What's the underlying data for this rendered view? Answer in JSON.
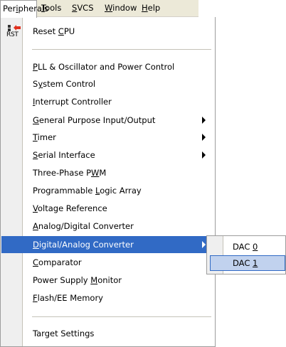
{
  "menubar": {
    "items": [
      {
        "pre": "Per",
        "key": "i",
        "post": "pherals"
      },
      {
        "pre": "",
        "key": "T",
        "post": "ools"
      },
      {
        "pre": "",
        "key": "S",
        "post": "VCS"
      },
      {
        "pre": "",
        "key": "W",
        "post": "indow"
      },
      {
        "pre": "",
        "key": "H",
        "post": "elp"
      }
    ]
  },
  "menu": {
    "reset": {
      "icon_text": "RST",
      "icon": "reset-cpu-icon",
      "pre": "Reset ",
      "key": "C",
      "post": "PU"
    },
    "items": [
      {
        "pre": "",
        "key": "P",
        "post": "LL & Oscillator and Power Control"
      },
      {
        "pre": "S",
        "key": "y",
        "post": "stem Control"
      },
      {
        "pre": "",
        "key": "I",
        "post": "nterrupt Controller"
      },
      {
        "pre": "",
        "key": "G",
        "post": "eneral Purpose Input/Output",
        "submenu": true
      },
      {
        "pre": "",
        "key": "T",
        "post": "imer",
        "submenu": true
      },
      {
        "pre": "",
        "key": "S",
        "post": "erial Interface",
        "submenu": true
      },
      {
        "pre": "Three-Phase P",
        "key": "W",
        "post": "M"
      },
      {
        "pre": "Programmable ",
        "key": "L",
        "post": "ogic Array"
      },
      {
        "pre": "",
        "key": "V",
        "post": "oltage Reference"
      },
      {
        "pre": "",
        "key": "A",
        "post": "nalog/Digital Converter"
      },
      {
        "pre": "",
        "key": "D",
        "post": "igital/Analog Converter",
        "submenu": true,
        "highlighted": true
      },
      {
        "pre": "",
        "key": "C",
        "post": "omparator"
      },
      {
        "pre": "Power Supply ",
        "key": "M",
        "post": "onitor"
      },
      {
        "pre": "",
        "key": "F",
        "post": "lash/EE Memory"
      }
    ],
    "target": {
      "pre": "Target Settings",
      "key": "",
      "post": ""
    }
  },
  "submenu": {
    "items": [
      {
        "pre": "DAC ",
        "key": "0",
        "post": ""
      },
      {
        "pre": "DAC ",
        "key": "1",
        "post": "",
        "selected": true
      }
    ]
  },
  "colors": {
    "highlight": "#316ac5",
    "selection": "#c1d2ee",
    "menubar": "#ece9d8",
    "gutter": "#efefef"
  }
}
